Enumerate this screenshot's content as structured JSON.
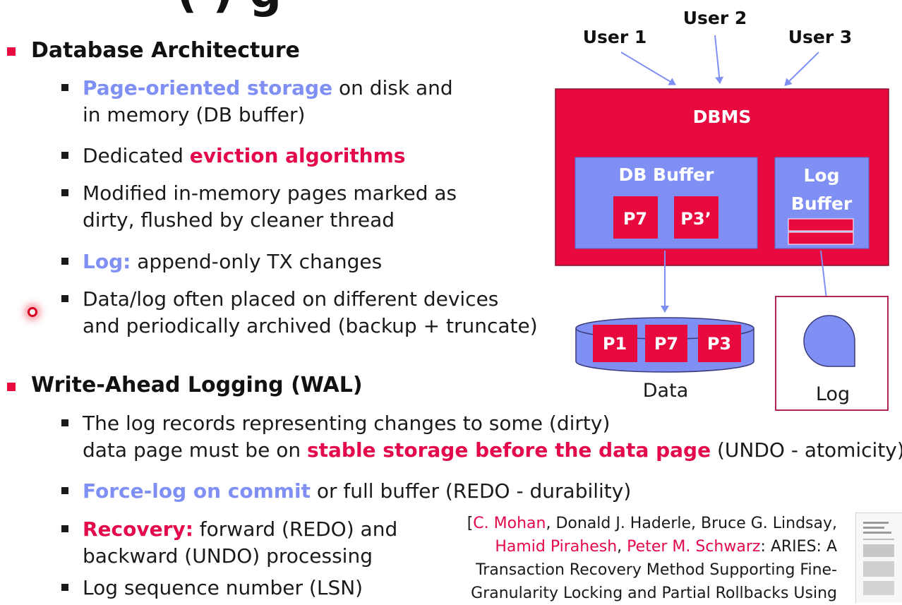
{
  "slide": {
    "title_fragment": "(                ) g",
    "sections": [
      {
        "heading": "Database Architecture",
        "bullets": [
          {
            "lines": [
              [
                {
                  "text": "Page-oriented storage",
                  "style": "blue"
                },
                {
                  "text": " on disk and"
                }
              ],
              [
                {
                  "text": "in memory (DB buffer)"
                }
              ]
            ]
          },
          {
            "lines": [
              [
                {
                  "text": "Dedicated "
                },
                {
                  "text": "eviction algorithms",
                  "style": "red"
                }
              ]
            ]
          },
          {
            "lines": [
              [
                {
                  "text": "Modified in-memory pages marked as"
                }
              ],
              [
                {
                  "text": "dirty, flushed by cleaner thread"
                }
              ]
            ]
          },
          {
            "lines": [
              [
                {
                  "text": "Log:",
                  "style": "blue"
                },
                {
                  "text": " append-only TX changes"
                }
              ]
            ]
          },
          {
            "lines": [
              [
                {
                  "text": "Data/log often placed on different devices"
                }
              ],
              [
                {
                  "text": "and periodically archived (backup + truncate)"
                }
              ]
            ]
          }
        ]
      },
      {
        "heading": "Write-Ahead Logging (WAL)",
        "bullets": [
          {
            "lines": [
              [
                {
                  "text": "The log records representing changes to some (dirty)"
                }
              ],
              [
                {
                  "text": "data page must be on "
                },
                {
                  "text": "stable storage before the data page",
                  "style": "red"
                },
                {
                  "text": " (UNDO - atomicity)"
                }
              ]
            ]
          },
          {
            "lines": [
              [
                {
                  "text": "Force-log on commit",
                  "style": "blue"
                },
                {
                  "text": " or full buffer (REDO - durability)"
                }
              ]
            ]
          },
          {
            "lines": [
              [
                {
                  "text": "Recovery:",
                  "style": "red"
                },
                {
                  "text": " forward (REDO) and"
                }
              ],
              [
                {
                  "text": "backward (UNDO) processing"
                }
              ]
            ]
          },
          {
            "lines": [
              [
                {
                  "text": "Log sequence number (LSN)"
                }
              ]
            ]
          }
        ]
      }
    ]
  },
  "diagram": {
    "users": [
      "User 1",
      "User 2",
      "User 3"
    ],
    "dbms_label": "DBMS",
    "db_buffer_label": "DB Buffer",
    "db_buffer_pages": [
      "P7",
      "P3’"
    ],
    "log_buffer_label_line1": "Log",
    "log_buffer_label_line2": "Buffer",
    "data_pages": [
      "P1",
      "P7",
      "P3"
    ],
    "data_label": "Data",
    "log_label": "Log",
    "colors": {
      "dbms": "#e8093f",
      "buffer": "#7f8ff3",
      "page": "#e8093f",
      "arrow": "#7f8ff3",
      "log_border": "#b0244e"
    }
  },
  "reference": {
    "lines": [
      [
        {
          "text": "["
        },
        {
          "text": "C. Mohan",
          "style": "author"
        },
        {
          "text": ", Donald J. Haderle, Bruce G. Lindsay,"
        }
      ],
      [
        {
          "text": "Hamid Pirahesh",
          "style": "author"
        },
        {
          "text": ", "
        },
        {
          "text": "Peter M. Schwarz",
          "style": "author"
        },
        {
          "text": ": ARIES: A"
        }
      ],
      [
        {
          "text": "Transaction Recovery Method Supporting Fine-"
        }
      ],
      [
        {
          "text": "Granularity Locking and Partial Rollbacks Using"
        }
      ]
    ]
  }
}
